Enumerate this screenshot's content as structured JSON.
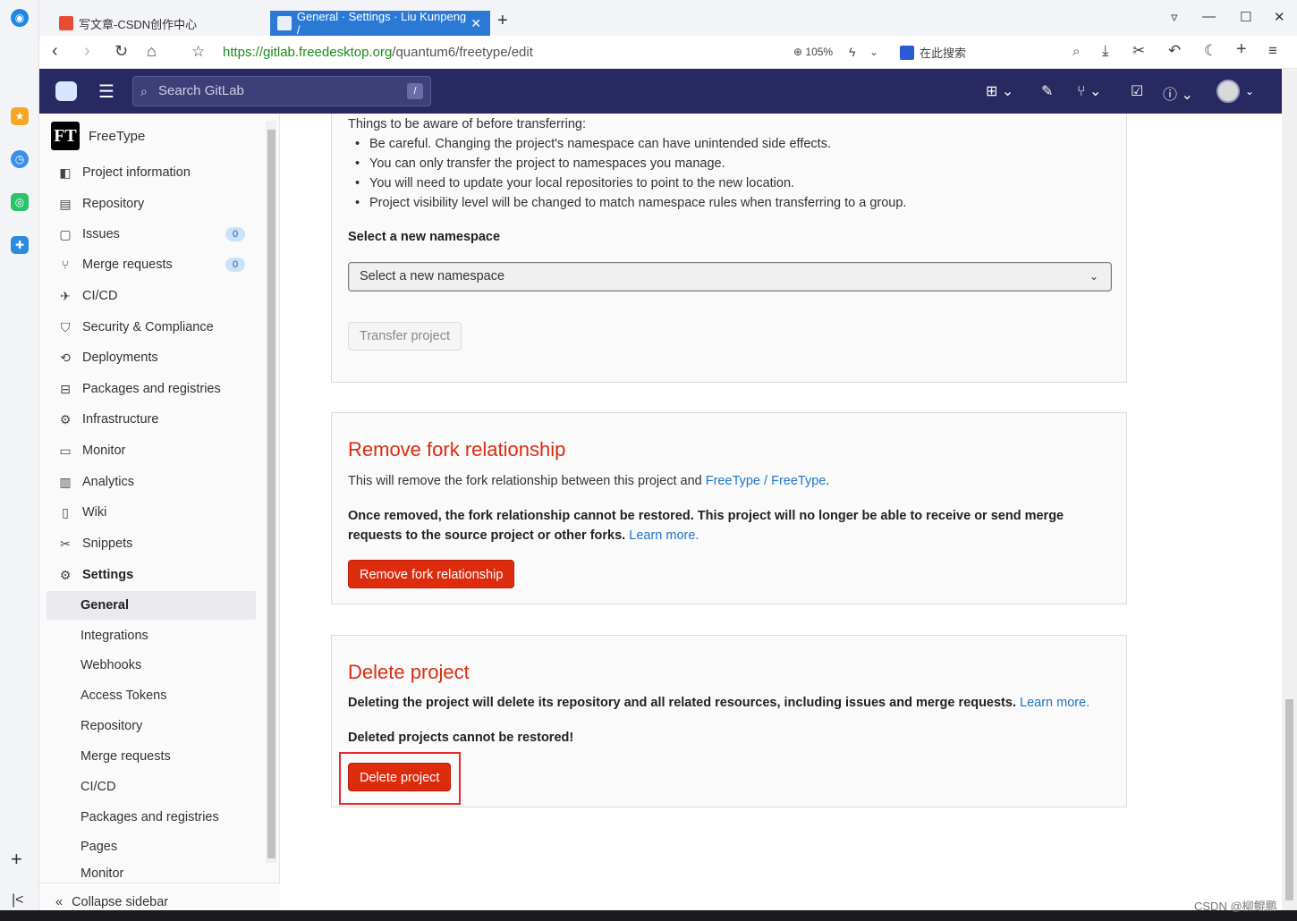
{
  "browser": {
    "tabs": [
      {
        "title": "写文章-CSDN创作中心",
        "active": false
      },
      {
        "title": "General · Settings · Liu Kunpeng /",
        "active": true
      }
    ],
    "url_domain": "https://gitlab.freedesktop.org",
    "url_path": "/quantum6/freetype/edit",
    "zoom": "105%",
    "search_placeholder": "在此搜索"
  },
  "header": {
    "search_placeholder": "Search GitLab",
    "search_shortcut": "/"
  },
  "sidebar": {
    "project_avatar": "FT",
    "project_name": "FreeType",
    "items": [
      {
        "label": "Project information",
        "icon": "info-icon"
      },
      {
        "label": "Repository",
        "icon": "doc-icon"
      },
      {
        "label": "Issues",
        "icon": "issues-icon",
        "badge": "0"
      },
      {
        "label": "Merge requests",
        "icon": "merge-icon",
        "badge": "0"
      },
      {
        "label": "CI/CD",
        "icon": "rocket-icon"
      },
      {
        "label": "Security & Compliance",
        "icon": "shield-icon"
      },
      {
        "label": "Deployments",
        "icon": "deploy-icon"
      },
      {
        "label": "Packages and registries",
        "icon": "package-icon"
      },
      {
        "label": "Infrastructure",
        "icon": "cloud-gear-icon"
      },
      {
        "label": "Monitor",
        "icon": "monitor-icon"
      },
      {
        "label": "Analytics",
        "icon": "chart-icon"
      },
      {
        "label": "Wiki",
        "icon": "book-icon"
      },
      {
        "label": "Snippets",
        "icon": "scissors-icon"
      },
      {
        "label": "Settings",
        "icon": "gear-icon"
      }
    ],
    "settings_sub": [
      {
        "label": "General",
        "active": true
      },
      {
        "label": "Integrations"
      },
      {
        "label": "Webhooks"
      },
      {
        "label": "Access Tokens"
      },
      {
        "label": "Repository"
      },
      {
        "label": "Merge requests"
      },
      {
        "label": "CI/CD"
      },
      {
        "label": "Packages and registries"
      },
      {
        "label": "Pages"
      },
      {
        "label": "Monitor"
      }
    ],
    "collapse_label": "Collapse sidebar"
  },
  "transfer": {
    "intro": "Things to be aware of before transferring:",
    "bullets": [
      "Be careful. Changing the project's namespace can have unintended side effects.",
      "You can only transfer the project to namespaces you manage.",
      "You will need to update your local repositories to point to the new location.",
      "Project visibility level will be changed to match namespace rules when transferring to a group."
    ],
    "namespace_label": "Select a new namespace",
    "namespace_value": "Select a new namespace",
    "button": "Transfer project"
  },
  "fork": {
    "title": "Remove fork relationship",
    "desc_prefix": "This will remove the fork relationship between this project and ",
    "desc_link": "FreeType / FreeType",
    "desc_suffix": ".",
    "warning_line1": "Once removed, the fork relationship cannot be restored. This project will no longer be able to receive or send merge",
    "warning_line2": "requests to the source project or other forks.",
    "learn_more": "Learn more.",
    "button": "Remove fork relationship"
  },
  "delete": {
    "title": "Delete project",
    "desc": "Deleting the project will delete its repository and all related resources, including issues and merge requests.",
    "learn_more": "Learn more.",
    "warning": "Deleted projects cannot be restored!",
    "button": "Delete project"
  },
  "watermark": "CSDN @柳鲲鹏",
  "colors": {
    "header": "#292961",
    "danger": "#dd2b0e",
    "link": "#1f75cb",
    "tab_active": "#2a7ad5",
    "highlight_box": "#e8262b"
  }
}
